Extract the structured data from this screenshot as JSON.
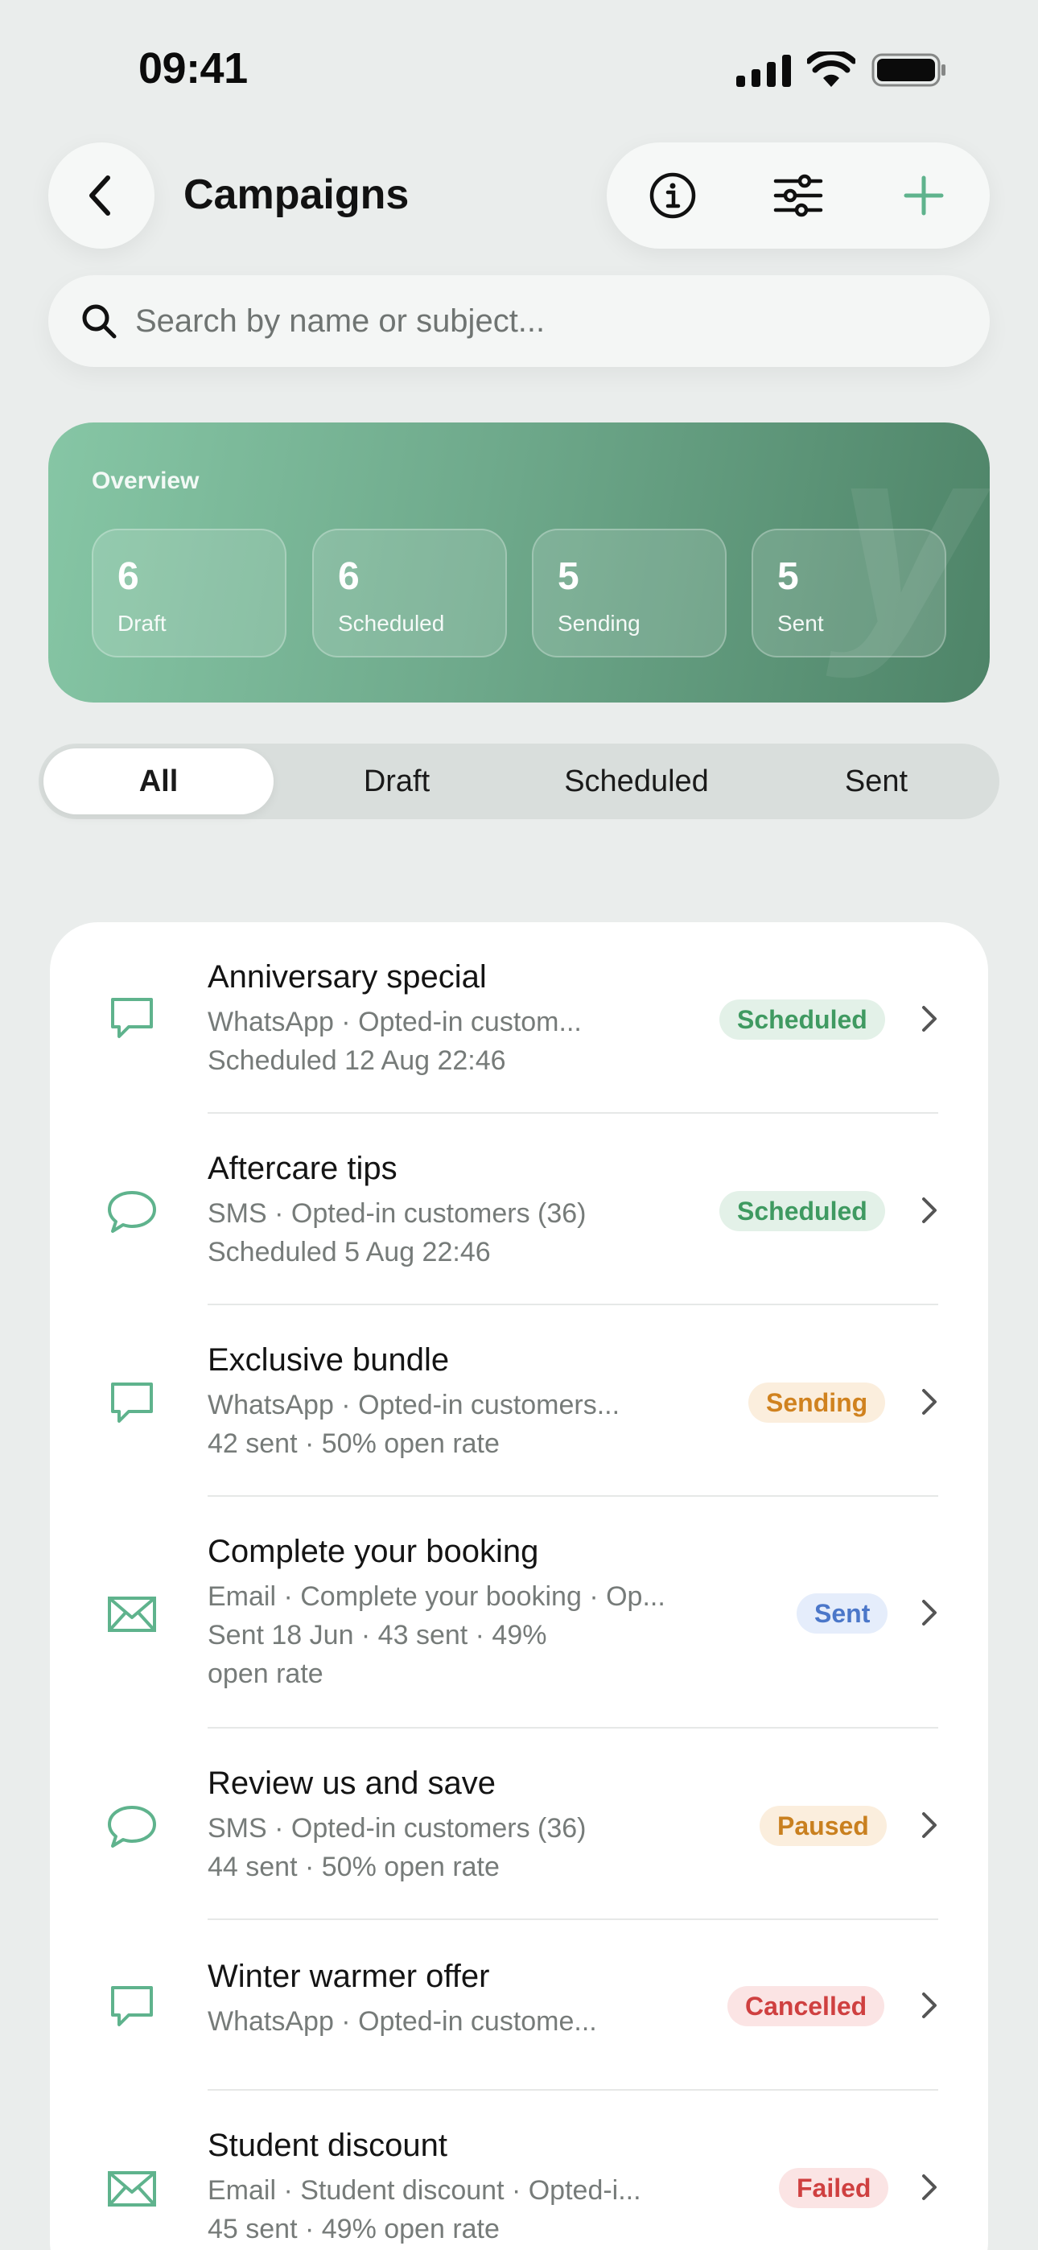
{
  "status_bar": {
    "time": "09:41"
  },
  "header": {
    "title": "Campaigns"
  },
  "search": {
    "placeholder": "Search by name or subject..."
  },
  "overview": {
    "label": "Overview",
    "stats": [
      {
        "value": "6",
        "label": "Draft"
      },
      {
        "value": "6",
        "label": "Scheduled"
      },
      {
        "value": "5",
        "label": "Sending"
      },
      {
        "value": "5",
        "label": "Sent"
      }
    ]
  },
  "tabs": [
    {
      "label": "All",
      "active": true
    },
    {
      "label": "Draft"
    },
    {
      "label": "Scheduled"
    },
    {
      "label": "Sent"
    }
  ],
  "campaigns": [
    {
      "icon": "whatsapp-message-icon",
      "title": "Anniversary special",
      "line1": "WhatsApp · Opted-in custom...",
      "line2": "Scheduled 12 Aug 22:46",
      "line3": "",
      "status": "Scheduled"
    },
    {
      "icon": "sms-message-icon",
      "title": "Aftercare tips",
      "line1": "SMS · Opted-in customers (36)",
      "line2": "Scheduled 5 Aug 22:46",
      "line3": "",
      "status": "Scheduled"
    },
    {
      "icon": "whatsapp-message-icon",
      "title": "Exclusive bundle",
      "line1": "WhatsApp · Opted-in customers...",
      "line2": "42 sent · 50% open rate",
      "line3": "",
      "status": "Sending"
    },
    {
      "icon": "email-envelope-icon",
      "title": "Complete your booking",
      "line1": "Email · Complete your booking · Op...",
      "line2": "Sent 18 Jun · 43 sent · 49%",
      "line3": "open rate",
      "status": "Sent"
    },
    {
      "icon": "sms-message-icon",
      "title": "Review us and save",
      "line1": "SMS · Opted-in customers (36)",
      "line2": "44 sent · 50% open rate",
      "line3": "",
      "status": "Paused"
    },
    {
      "icon": "whatsapp-message-icon",
      "title": "Winter warmer offer",
      "line1": "WhatsApp · Opted-in custome...",
      "line2": "",
      "line3": "",
      "status": "Cancelled"
    },
    {
      "icon": "email-envelope-icon",
      "title": "Student discount",
      "line1": "Email · Student discount · Opted-i...",
      "line2": "45 sent · 49% open rate",
      "line3": "",
      "status": "Failed"
    }
  ],
  "colors": {
    "accent": "#5fb38d",
    "scheduled_bg": "#e3f1e8",
    "scheduled_fg": "#3f9a61",
    "sending_bg": "#fbeedd",
    "sending_fg": "#d0821f",
    "sent_bg": "#e5edfb",
    "sent_fg": "#4b77c9",
    "paused_bg": "#fbeedd",
    "paused_fg": "#c9801f",
    "cancelled_bg": "#fbe4e4",
    "cancelled_fg": "#cf4040",
    "failed_bg": "#fbe4e4",
    "failed_fg": "#cf4040"
  }
}
